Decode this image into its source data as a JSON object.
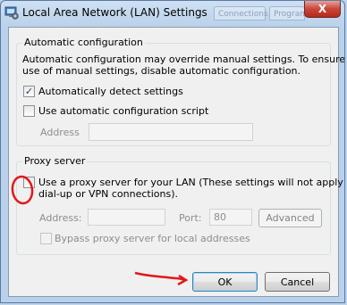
{
  "window": {
    "title": "Local Area Network (LAN) Settings",
    "close_symbol": "X",
    "background_tabs": [
      "Connections",
      "Programs"
    ]
  },
  "automatic_configuration": {
    "group_title": "Automatic configuration",
    "description_line1": "Automatic configuration may override manual settings.  To ensure the",
    "description_line2": "use of manual settings, disable automatic configuration.",
    "detect_settings": {
      "label": "Automatically detect settings",
      "checked": true
    },
    "use_script": {
      "label": "Use automatic configuration script",
      "checked": false
    },
    "address_label": "Address",
    "address_value": ""
  },
  "proxy_server": {
    "group_title": "Proxy server",
    "use_proxy": {
      "label_line1": "Use a proxy server for your LAN (These settings will not apply to",
      "label_line2": "dial-up or VPN connections).",
      "checked": false
    },
    "address_label": "Address:",
    "address_value": "",
    "port_label": "Port:",
    "port_value": "80",
    "advanced_label": "Advanced",
    "bypass_local": {
      "label": "Bypass proxy server for local addresses",
      "checked": false
    }
  },
  "buttons": {
    "ok_label": "OK",
    "cancel_label": "Cancel"
  },
  "colors": {
    "annotation_red": "#e0191b",
    "accent_blue": "#3c7fb1",
    "checkmark": "#2a3d6b"
  },
  "icons": [
    "network-settings-icon",
    "close-icon",
    "checkmark-icon"
  ]
}
